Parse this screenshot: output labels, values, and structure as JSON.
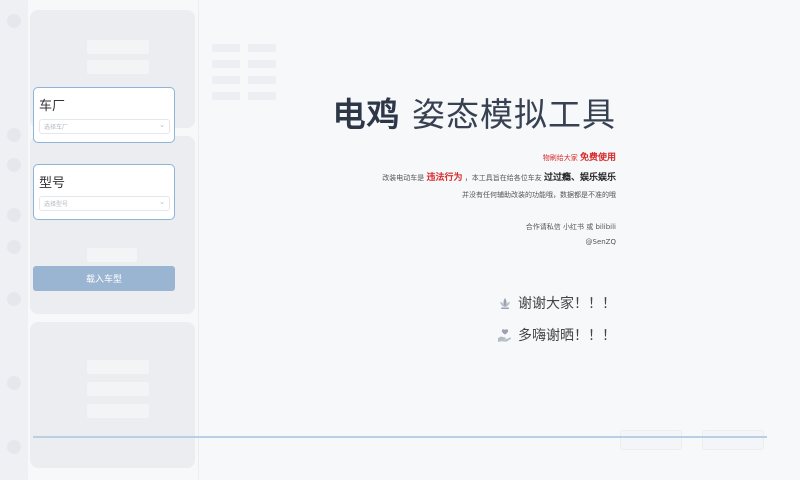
{
  "form": {
    "manufacturer": {
      "label": "车厂",
      "placeholder": "选择车厂"
    },
    "model": {
      "label": "型号",
      "placeholder": "选择型号"
    },
    "load_button": "载入车型"
  },
  "hero": {
    "title_bold": "电鸡",
    "title_rest": "姿态模拟工具",
    "free_prefix": "物刷给大家",
    "free_strong": "免费使用",
    "illegal_prefix": "改装电动车是",
    "illegal_strong": "违法行为",
    "illegal_middle": "，本工具旨在给各位车友",
    "illegal_fun": "过过瘾、娱乐娱乐",
    "disclaimer": "并没有任何辅助改装的功能哦，数据都是不准的哦",
    "contact_line": "合作请私信 小红书 或 bilibili",
    "contact_handle": "@SenZQ",
    "thanks_1": "谢谢大家！！！",
    "thanks_2": "多嗨谢晒！！！"
  },
  "icons": {
    "thanks_1": "lotus-icon",
    "thanks_2": "hand-heart-icon"
  },
  "colors": {
    "accent_border": "#8fb3d9",
    "button_bg": "#9ab5d1",
    "highlight_red": "#d72b2b",
    "bottom_line": "#b9cfe3"
  }
}
